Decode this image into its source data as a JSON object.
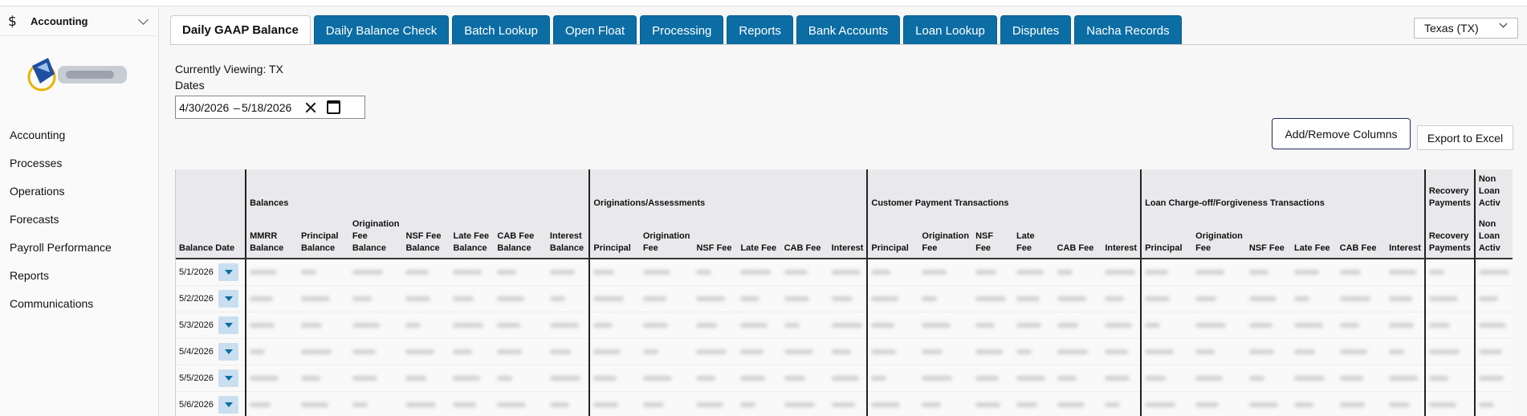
{
  "sidebar": {
    "header_title": "Accounting",
    "nav": [
      "Accounting",
      "Processes",
      "Operations",
      "Forecasts",
      "Payroll Performance",
      "Reports",
      "Communications"
    ]
  },
  "tabs": [
    "Daily GAAP Balance",
    "Daily Balance Check",
    "Batch Lookup",
    "Open Float",
    "Processing",
    "Reports",
    "Bank Accounts",
    "Loan Lookup",
    "Disputes",
    "Nacha Records"
  ],
  "active_tab": 0,
  "state_select": "Texas (TX)",
  "viewing": "Currently Viewing: TX",
  "dates": {
    "label": "Dates",
    "start": "4/30/2026",
    "separator": "–",
    "end": "5/18/2026"
  },
  "buttons": {
    "add_remove": "Add/Remove Columns",
    "export": "Export to Excel"
  },
  "grid": {
    "groups": [
      {
        "label": "",
        "span": 1
      },
      {
        "label": "Balances",
        "span": 7
      },
      {
        "label": "Originations/Assessments",
        "span": 6
      },
      {
        "label": "Customer Payment Transactions",
        "span": 6
      },
      {
        "label": "Loan Charge-off/Forgiveness Transactions",
        "span": 6
      },
      {
        "label": "Recovery Payments",
        "span": 1
      },
      {
        "label": "Non Loan Activ",
        "span": 1
      }
    ],
    "columns": [
      "Balance Date",
      "MMRR Balance",
      "Principal Balance",
      "Origination Fee Balance",
      "NSF Fee Balance",
      "Late Fee Balance",
      "CAB Fee Balance",
      "Interest Balance",
      "Principal",
      "Origination Fee",
      "NSF Fee",
      "Late Fee",
      "CAB Fee",
      "Interest",
      "Principal",
      "Origination Fee",
      "NSF Fee",
      "Late Fee",
      "CAB Fee",
      "Interest",
      "Principal",
      "Origination Fee",
      "NSF Fee",
      "Late Fee",
      "CAB Fee",
      "Interest",
      "Recovery Payments",
      "Non Loan Activ"
    ],
    "rows": [
      "5/1/2026",
      "5/2/2026",
      "5/3/2026",
      "5/4/2026",
      "5/5/2026",
      "5/6/2026"
    ]
  }
}
